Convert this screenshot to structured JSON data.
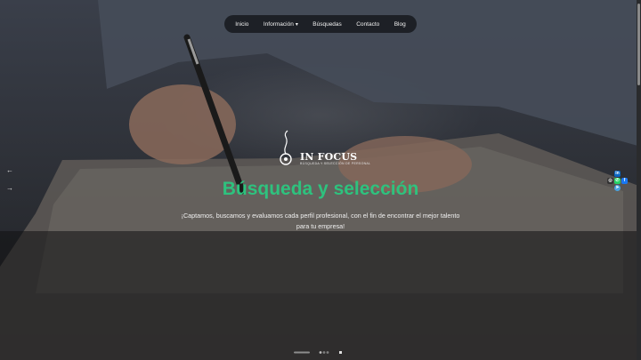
{
  "nav": {
    "items": [
      {
        "label": "Inicio"
      },
      {
        "label": "Información"
      },
      {
        "label": "Búsquedas"
      },
      {
        "label": "Contacto"
      },
      {
        "label": "Blog"
      }
    ],
    "caret": "▾"
  },
  "hero": {
    "brand": "IN FOCUS",
    "tagline": "BÚSQUEDA Y SELECCIÓN DE PERSONAL",
    "title": "Búsqueda y selección",
    "subtitle": "¡Captamos, buscamos y evaluamos cada perfil profesional, con el fin de encontrar el mejor talento para tu empresa!"
  },
  "arrows": {
    "prev": "←",
    "next": "→"
  },
  "social": [
    {
      "name": "linkedin-icon",
      "glyph": "in",
      "color": "#0a66c2"
    },
    {
      "name": "instagram-icon",
      "glyph": "◎",
      "color": "#333333"
    },
    {
      "name": "whatsapp-icon",
      "glyph": "✆",
      "color": "#25d366"
    },
    {
      "name": "facebook-icon",
      "glyph": "f",
      "color": "#1877f2"
    },
    {
      "name": "telegram-icon",
      "glyph": "➤",
      "color": "#4aa3e0"
    }
  ],
  "colors": {
    "accent": "#2ec27e",
    "text": "#f0f0f0",
    "nav_bg": "#121418"
  }
}
